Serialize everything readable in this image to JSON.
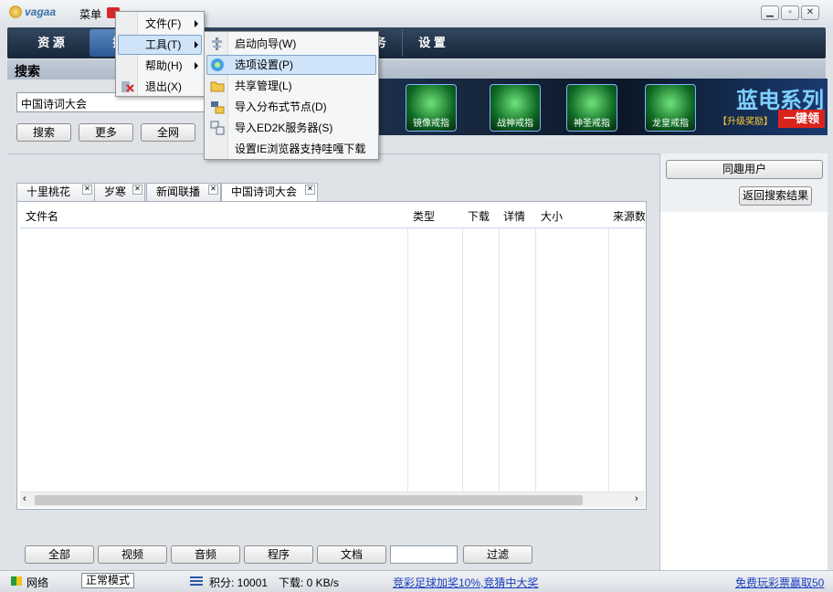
{
  "app": {
    "logo": "vagaa",
    "menu_label": "菜单"
  },
  "nav": {
    "tabs": [
      "资 源",
      "搜 索",
      "任 务",
      "设 置"
    ],
    "active": 1
  },
  "search": {
    "title": "搜索",
    "query": "中国诗词大会",
    "buttons": [
      "搜索",
      "更多",
      "全网"
    ]
  },
  "banner": {
    "icons": [
      "镜像戒指",
      "战神戒指",
      "神圣戒指",
      "龙皇戒指"
    ],
    "headline": "蓝电系列",
    "sub": "【升级奖励】",
    "cta": "一键领"
  },
  "result_tabs": [
    {
      "label": "十里桃花",
      "active": false
    },
    {
      "label": "岁寒",
      "active": false
    },
    {
      "label": "新闻联播",
      "active": false
    },
    {
      "label": "中国诗词大会",
      "active": true
    }
  ],
  "columns": [
    "文件名",
    "类型",
    "下载",
    "详情",
    "大小",
    "来源数"
  ],
  "filters": {
    "buttons": [
      "全部",
      "视频",
      "音频",
      "程序",
      "文档"
    ],
    "filter_input": "",
    "filter_button": "过滤"
  },
  "right_panel": {
    "header": "同趣用户",
    "back_button": "返回搜索结果"
  },
  "status": {
    "network": "网络",
    "mode": "正常模式",
    "points": "积分: 10001",
    "speed": "下载: 0 KB/s",
    "link1": "竞彩足球加奖10%,竞猜中大奖",
    "link2": "免费玩彩票赢取50"
  },
  "menu": {
    "items": [
      {
        "label": "文件(F)",
        "submenu": true
      },
      {
        "label": "工具(T)",
        "submenu": true,
        "highlighted": true
      },
      {
        "label": "帮助(H)",
        "submenu": true
      },
      {
        "label": "退出(X)",
        "submenu": false
      }
    ]
  },
  "submenu": {
    "items": [
      {
        "label": "启动向导(W)",
        "icon": "wizard-icon"
      },
      {
        "label": "选项设置(P)",
        "icon": "options-icon",
        "highlighted": true
      },
      {
        "label": "共享管理(L)",
        "icon": "folder-share-icon"
      },
      {
        "label": "导入分布式节点(D)",
        "icon": "nodes-icon"
      },
      {
        "label": "导入ED2K服务器(S)",
        "icon": "server-icon"
      },
      {
        "label": "设置IE浏览器支持哇嘎下载",
        "icon": ""
      }
    ]
  },
  "colors": {
    "nav_bg": "#17263a",
    "highlight": "#cfe4f8",
    "link": "#1a3fbf"
  }
}
